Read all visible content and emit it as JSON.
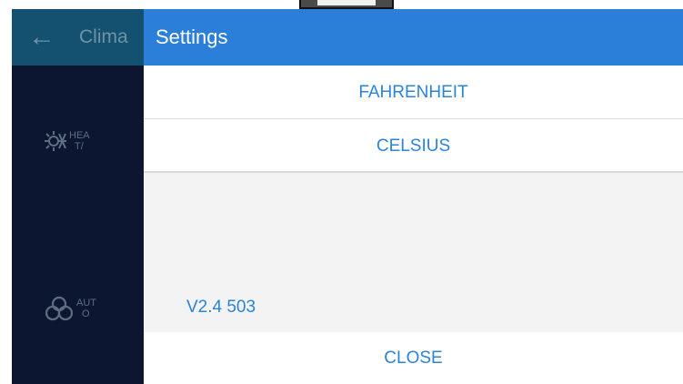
{
  "background_app": {
    "title": "Clima",
    "back_icon": "arrow-left-icon",
    "row1": {
      "icon": "sun-snowflake-icon",
      "label_line1": "HEA",
      "label_line2": "T/"
    },
    "row2": {
      "icon": "fan-icon",
      "label_line1": "AUT",
      "label_line2": "O"
    }
  },
  "dialog": {
    "title": "Settings",
    "options": [
      "FAHRENHEIT",
      "CELSIUS"
    ],
    "version": "V2.4 503",
    "close_label": "CLOSE"
  },
  "colors": {
    "accent": "#2b7fd8",
    "bg_header": "#14506f",
    "bg_panel": "#0c1630",
    "link_text": "#2b84d8"
  }
}
